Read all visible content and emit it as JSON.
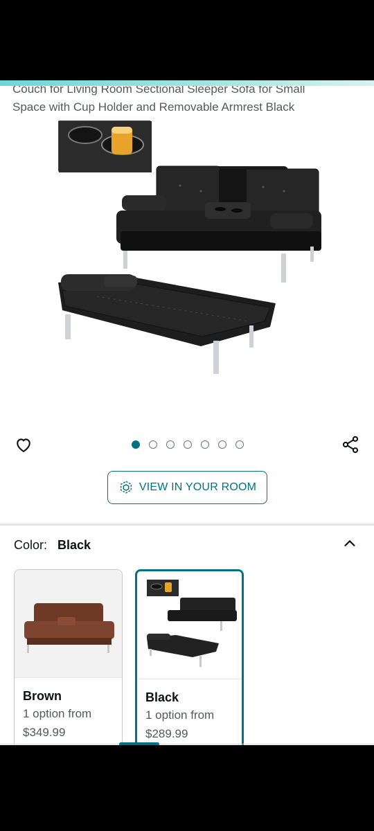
{
  "product": {
    "title_line1": "Couch for Living Room Sectional Sleeper Sofa for Small",
    "title_line2": "Space with Cup Holder and Removable Armrest Black"
  },
  "gallery": {
    "image_count": 7,
    "active_index": 0,
    "view_in_room_label": "VIEW IN YOUR ROOM"
  },
  "icons": {
    "wishlist": "heart-icon",
    "share": "share-icon",
    "ar": "cube-icon",
    "collapse": "chevron-up-icon"
  },
  "color_selector": {
    "label": "Color:",
    "selected": "Black",
    "options": [
      {
        "name": "Brown",
        "availability": "1 option from",
        "price": "$349.99",
        "selected": false
      },
      {
        "name": "Black",
        "availability": "1 option from",
        "price": "$289.99",
        "selected": true
      }
    ]
  },
  "colors": {
    "accent": "#007185",
    "text": "#0f1111",
    "muted": "#565959"
  }
}
